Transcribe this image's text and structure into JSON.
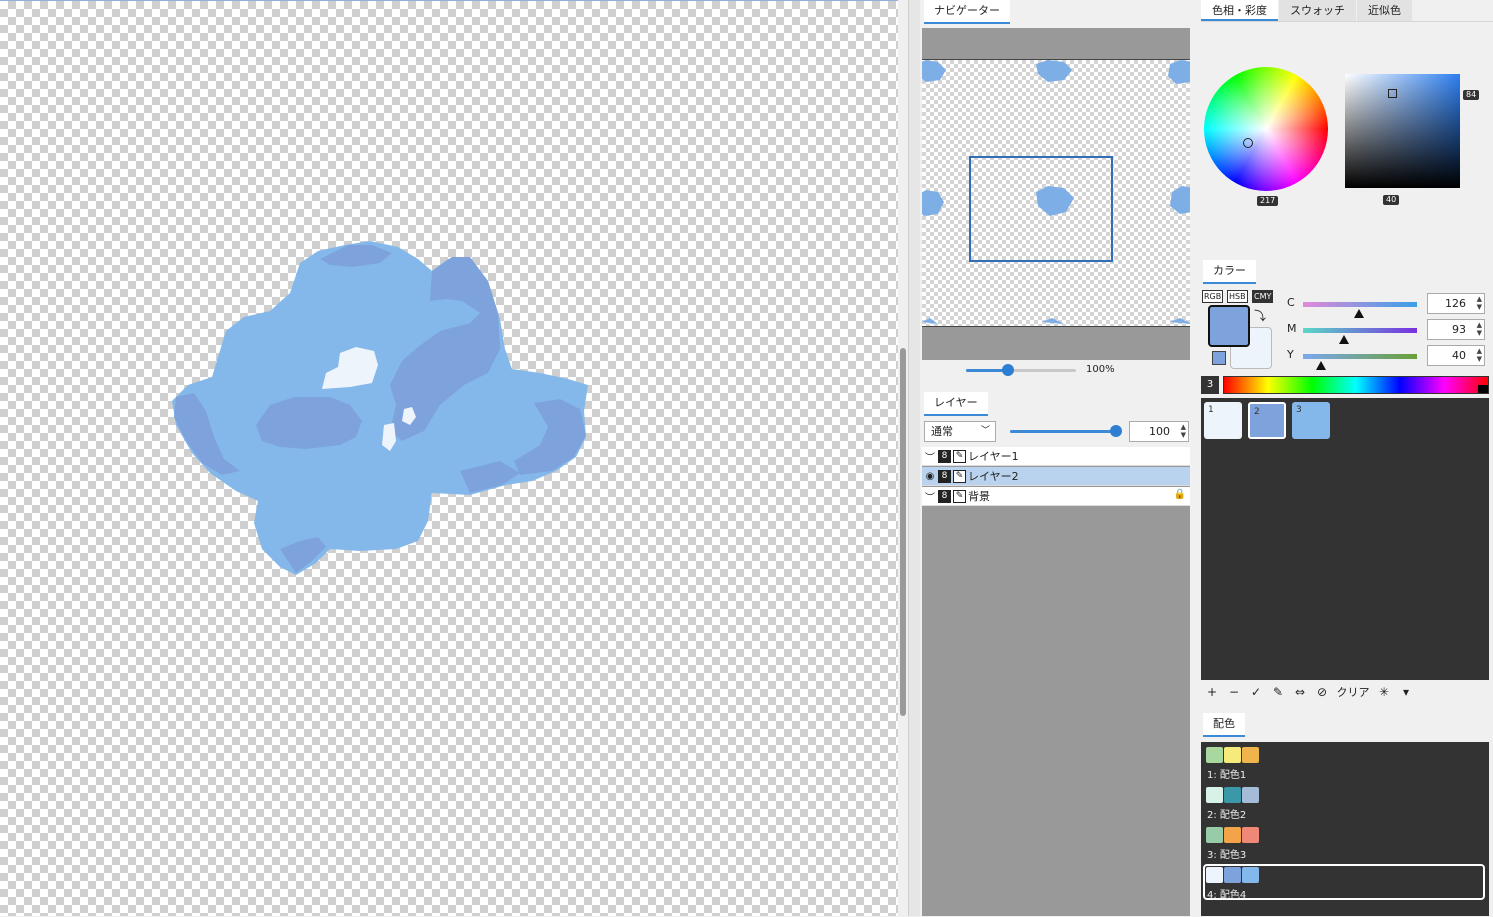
{
  "navigator": {
    "tab": "ナビゲーター",
    "zoom": "100%",
    "zoom_fraction": 0.38
  },
  "layer": {
    "tab": "レイヤー",
    "blend_mode": "通常",
    "opacity": "100",
    "opacity_fraction": 1.0,
    "layers": [
      {
        "name": "レイヤー1",
        "selected": false,
        "locked": false
      },
      {
        "name": "レイヤー2",
        "selected": true,
        "locked": false
      },
      {
        "name": "背景",
        "selected": false,
        "locked": true
      }
    ]
  },
  "color_tabs": {
    "hue_sat": "色相・彩度",
    "swatch": "スウォッチ",
    "approx": "近似色"
  },
  "hue": {
    "hue_value": "217",
    "sat_value": "40",
    "bright_value": "84"
  },
  "color": {
    "tab": "カラー",
    "modes": [
      "RGB",
      "HSB",
      "CMY"
    ],
    "active_mode": "CMY",
    "foreground": "#7ea3dc",
    "background": "#eef4fc",
    "channels": [
      {
        "label": "C",
        "value": "126",
        "fraction": 0.49
      },
      {
        "label": "M",
        "value": "93",
        "fraction": 0.36
      },
      {
        "label": "Y",
        "value": "40",
        "fraction": 0.16
      }
    ]
  },
  "palette": {
    "count": "3",
    "swatches": [
      {
        "label": "1",
        "color": "#eef4fc"
      },
      {
        "label": "2",
        "color": "#7ea3dc"
      },
      {
        "label": "3",
        "color": "#84b8ea"
      }
    ],
    "tools": {
      "add": "+",
      "remove": "−",
      "check": "✓",
      "pen": "✎",
      "swap": "⇔",
      "ban": "⊘",
      "clear": "クリア",
      "sparkle": "✳",
      "menu": "▾"
    }
  },
  "scheme": {
    "tab": "配色",
    "items": [
      {
        "name": "1: 配色1",
        "colors": [
          "#a8d8a0",
          "#f5ea7a",
          "#f0b44c"
        ]
      },
      {
        "name": "2: 配色2",
        "colors": [
          "#d9f2e8",
          "#3a98a8",
          "#a4bcd8"
        ]
      },
      {
        "name": "3: 配色3",
        "colors": [
          "#98cca8",
          "#f4a448",
          "#f08878"
        ]
      },
      {
        "name": "4: 配色4",
        "colors": [
          "#eef4fc",
          "#7ea3dc",
          "#84b8ea"
        ],
        "selected": true
      }
    ]
  }
}
